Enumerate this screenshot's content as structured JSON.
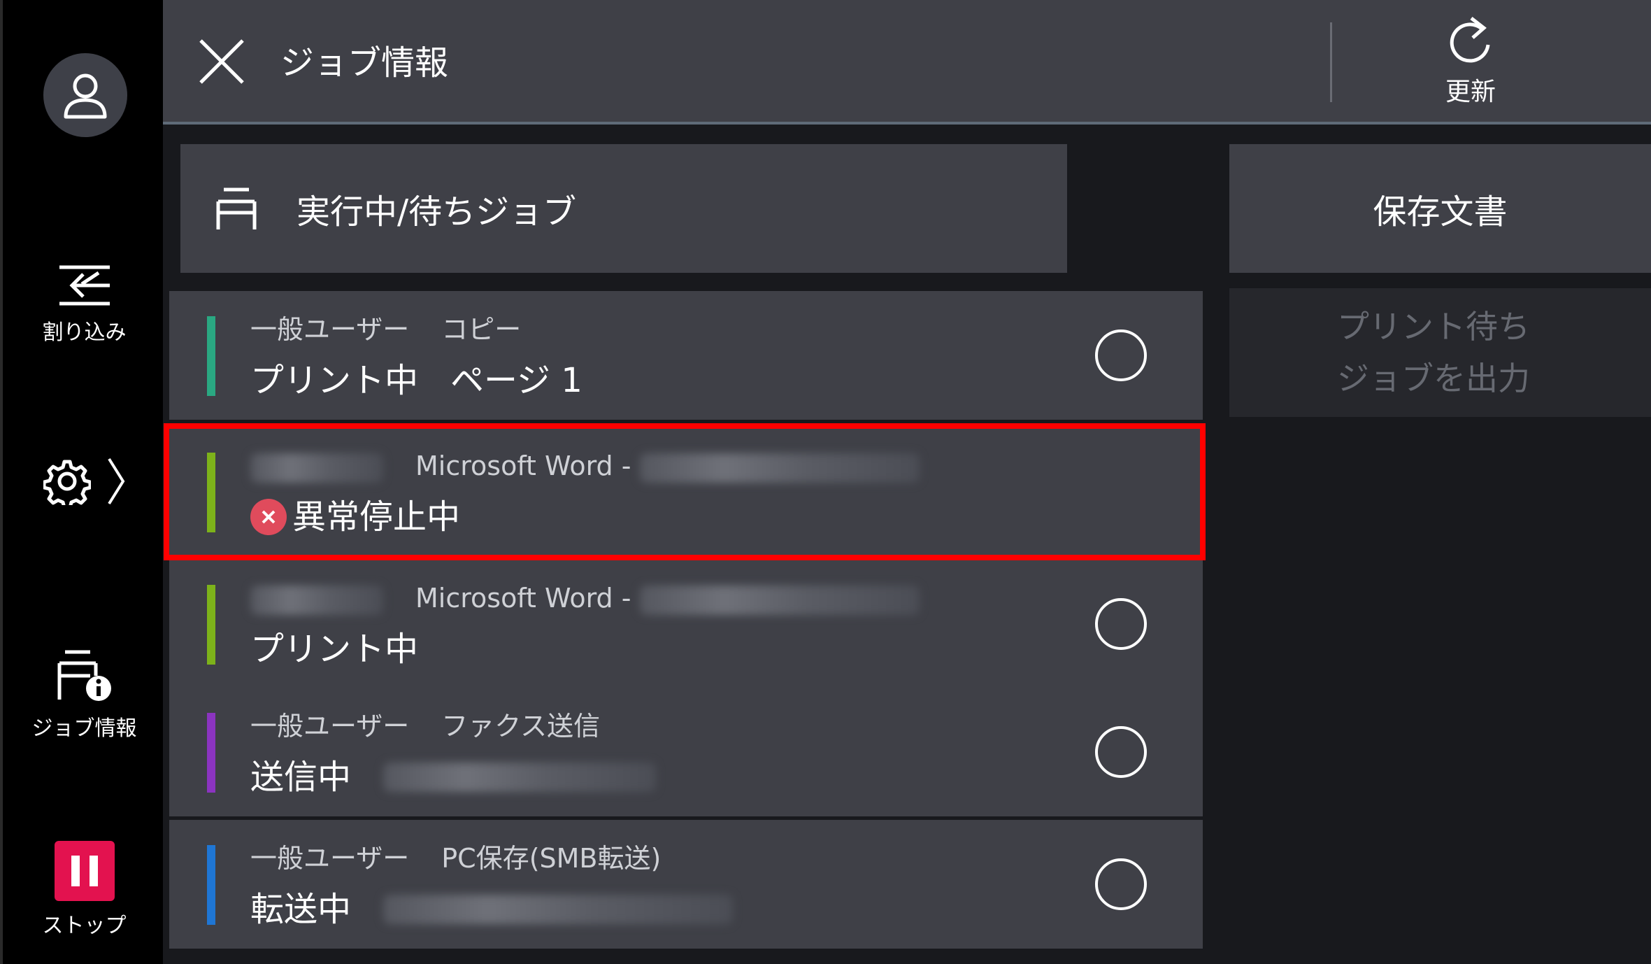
{
  "header": {
    "title": "ジョブ情報",
    "refresh_label": "更新"
  },
  "sidebar": {
    "interrupt_label": "割り込み",
    "job_info_label": "ジョブ情報",
    "stop_label": "ストップ"
  },
  "tabs": {
    "active_jobs": "実行中/待ちジョブ",
    "saved_docs": "保存文書"
  },
  "right_panel": {
    "print_waiting": "プリント待ち\nジョブを出力"
  },
  "jobs": [
    {
      "owner": "一般ユーザー",
      "type": "コピー",
      "status": "プリント中",
      "detail": "ページ 1",
      "color": "#2aa882"
    },
    {
      "type": "Microsoft Word -",
      "status": "異常停止中",
      "color": "#7db21a"
    },
    {
      "type": "Microsoft Word -",
      "status": "プリント中",
      "color": "#7db21a"
    },
    {
      "owner": "一般ユーザー",
      "type": "ファクス送信",
      "status": "送信中",
      "color": "#8b34c0"
    },
    {
      "owner": "一般ユーザー",
      "type": "PC保存(SMB転送)",
      "status": "転送中",
      "color": "#1f76d4"
    }
  ],
  "colors": {
    "stop": "#e3124f",
    "error": "#e04b5c",
    "highlight": "#ff0000"
  }
}
